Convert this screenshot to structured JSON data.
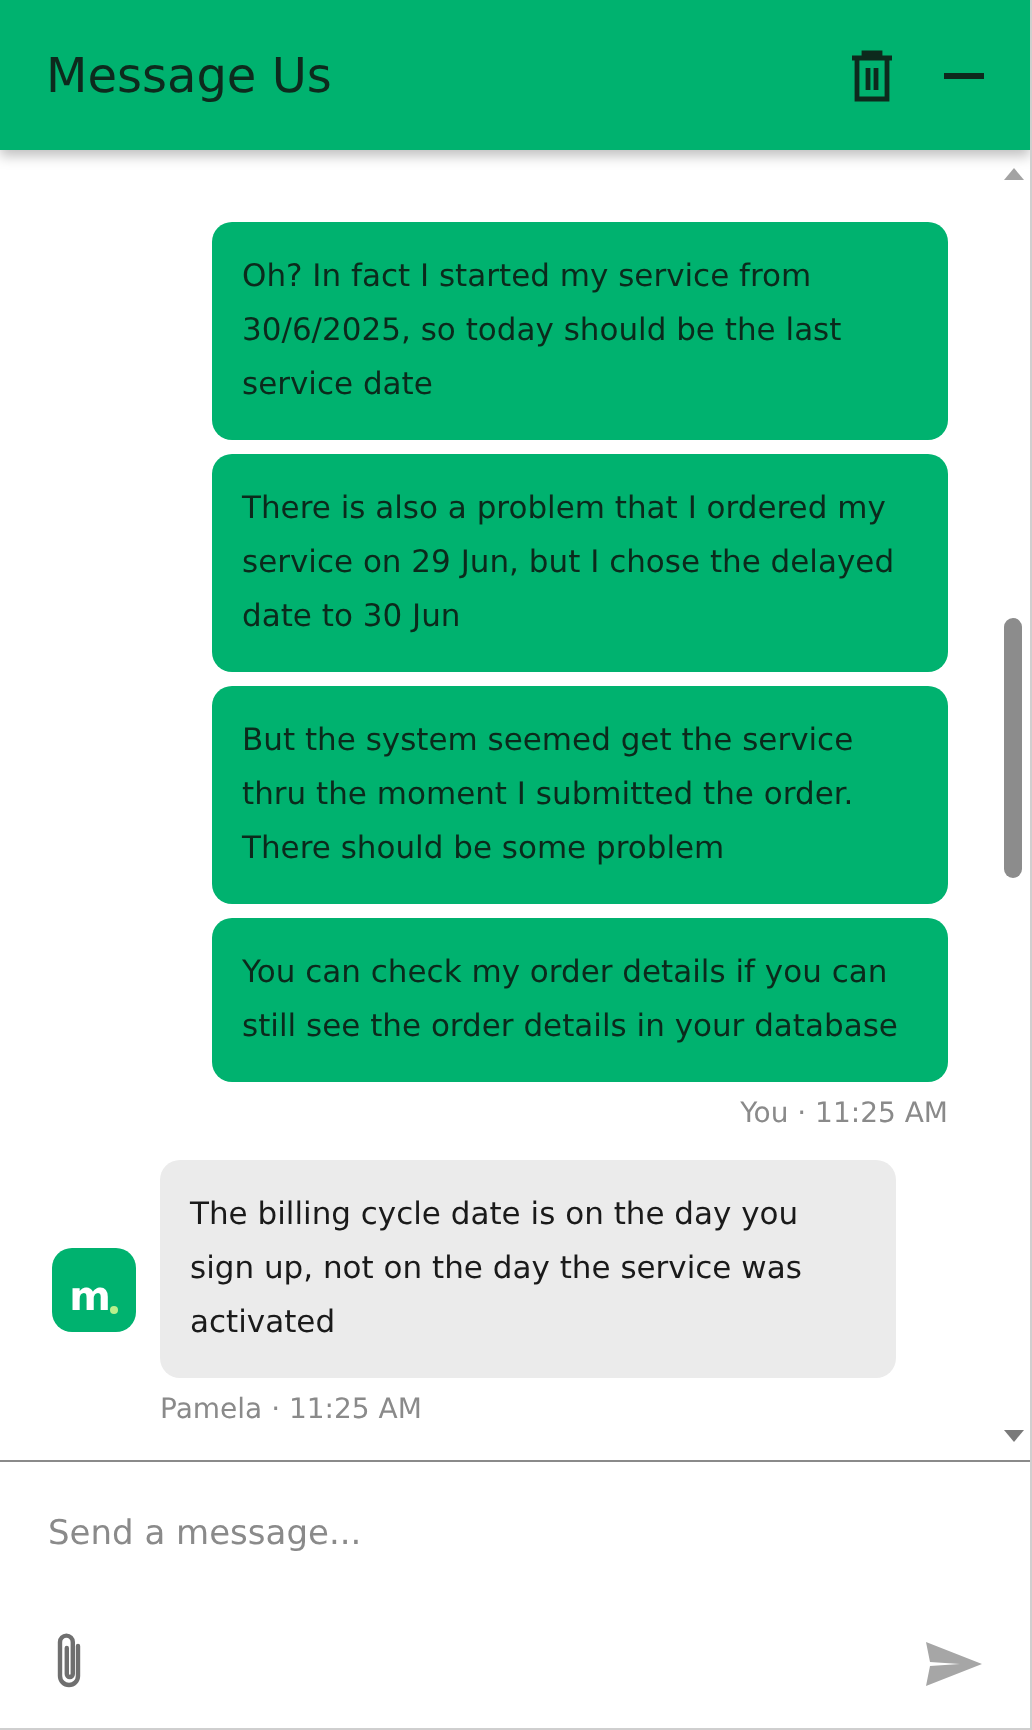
{
  "header": {
    "title": "Message Us"
  },
  "groups": [
    {
      "kind": "user",
      "bubbles": [
        "Oh? In fact I started my service from 30/6/2025, so today should be the last service date",
        "There is also a problem that I ordered my service on 29 Jun, but I chose the delayed date to 30 Jun",
        "But the system seemed get the service thru the moment I submitted the order. There should be some problem",
        "You can check my order details if you can still see the order details in your database"
      ],
      "meta": "You · 11:25 AM"
    },
    {
      "kind": "agent",
      "avatar": "m",
      "bubbles": [
        "The billing cycle date is on the day you sign up, not on the day the service was activated"
      ],
      "meta": "Pamela · 11:25 AM"
    }
  ],
  "composer": {
    "placeholder": "Send a message..."
  }
}
